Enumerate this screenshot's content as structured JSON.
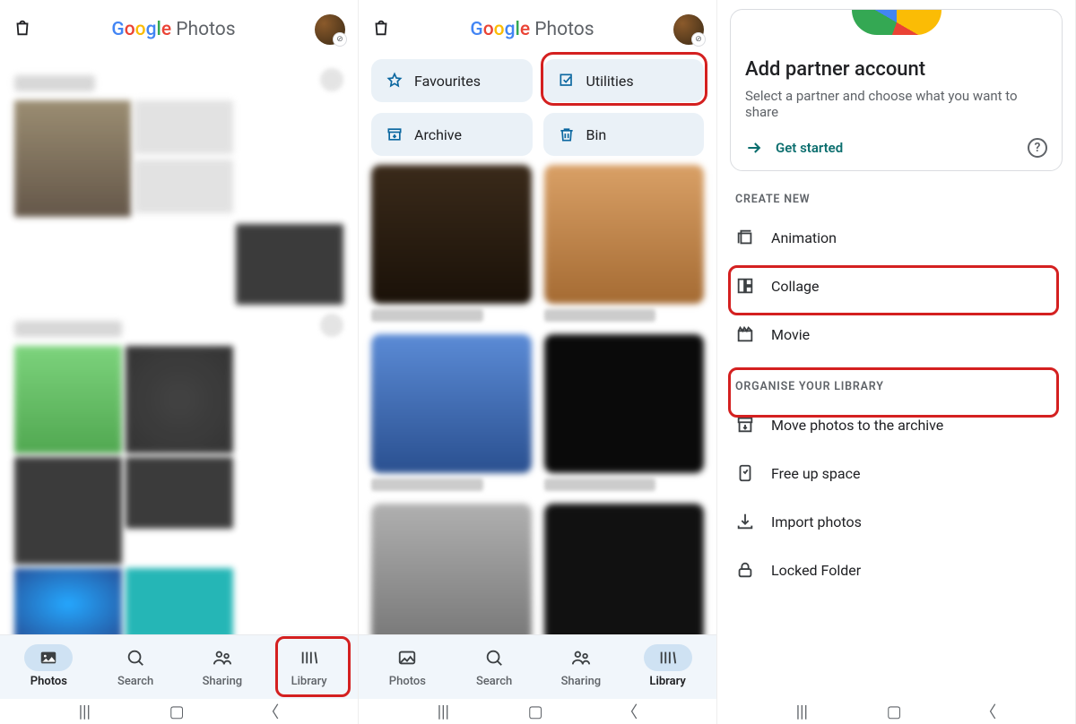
{
  "app_title": "Google Photos",
  "nav": {
    "photos": "Photos",
    "search": "Search",
    "sharing": "Sharing",
    "library": "Library"
  },
  "panel2": {
    "chips": {
      "favourites": "Favourites",
      "utilities": "Utilities",
      "archive": "Archive",
      "bin": "Bin"
    }
  },
  "panel3": {
    "partner": {
      "title": "Add partner account",
      "subtitle": "Select a partner and choose what you want to share",
      "cta": "Get started"
    },
    "create_new_label": "CREATE NEW",
    "create": {
      "animation": "Animation",
      "collage": "Collage",
      "movie": "Movie"
    },
    "organise_label": "ORGANISE YOUR LIBRARY",
    "organise": {
      "archive": "Move photos to the archive",
      "free_up": "Free up space",
      "import": "Import photos",
      "locked": "Locked Folder"
    }
  }
}
